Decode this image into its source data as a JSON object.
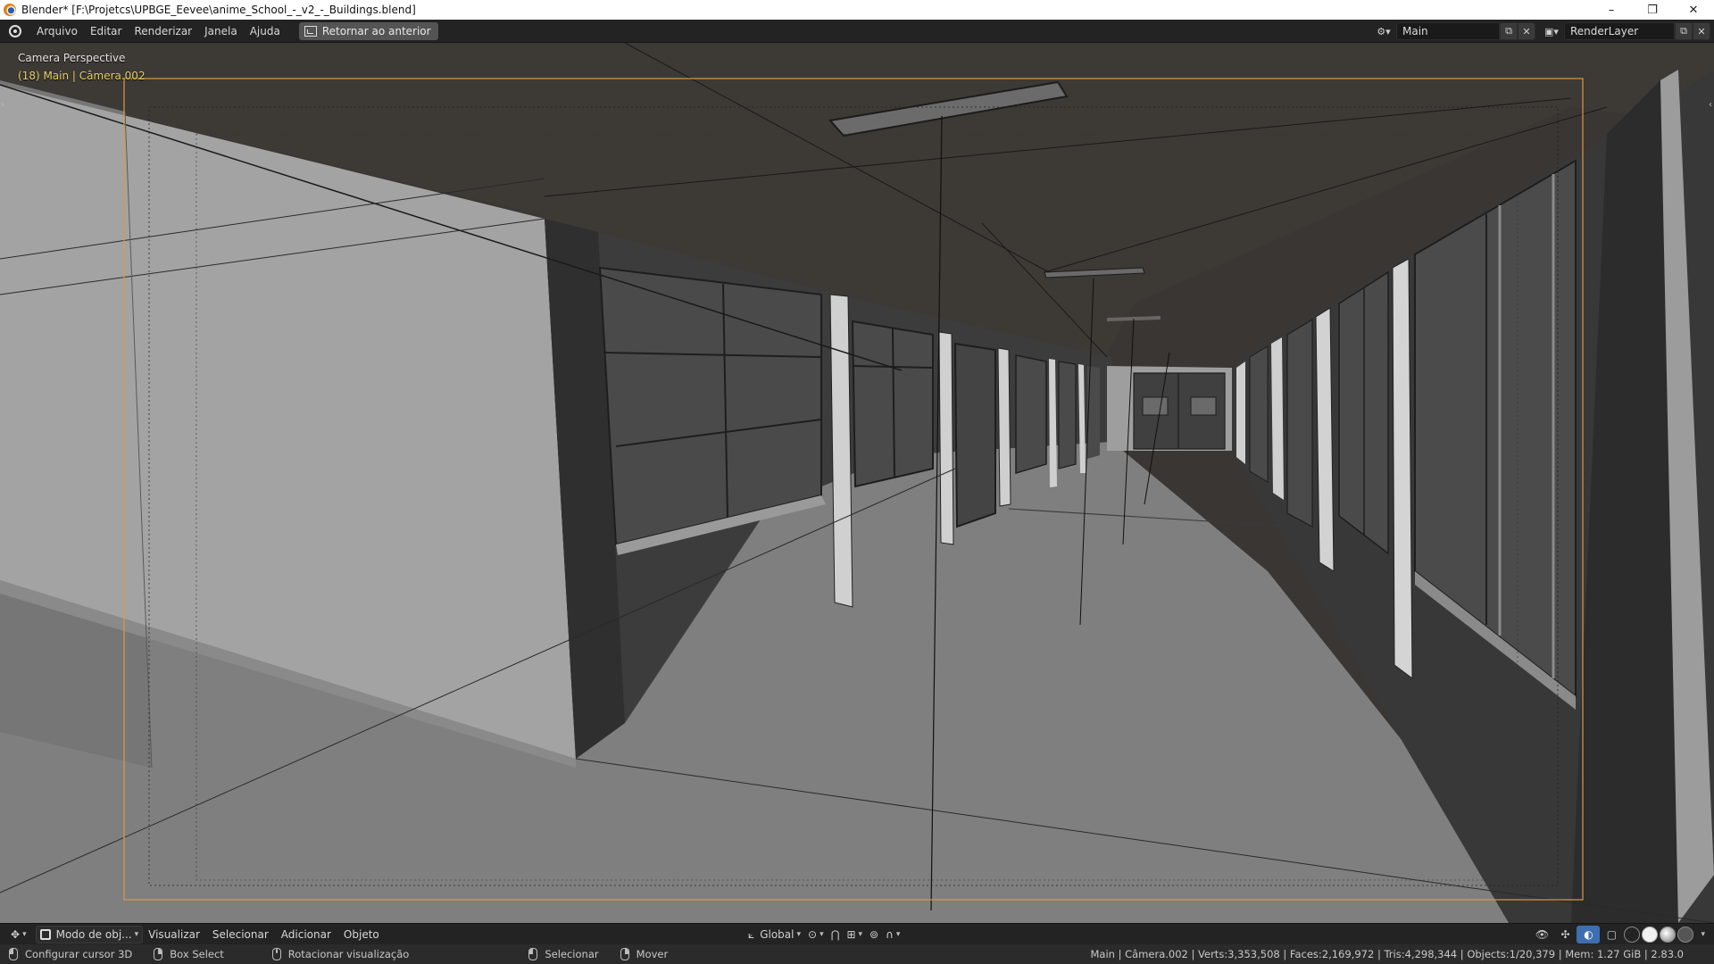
{
  "window": {
    "title": "Blender* [F:\\Projetcs\\UPBGE_Eevee\\anime_School_-_v2_-_Buildings.blend]",
    "controls": {
      "minimize": "–",
      "maximize": "❐",
      "close": "✕"
    }
  },
  "menu": {
    "items": [
      "Arquivo",
      "Editar",
      "Renderizar",
      "Janela",
      "Ajuda"
    ],
    "back_button": "Retornar ao anterior"
  },
  "scene": {
    "name": "Main",
    "render_layer": "RenderLayer"
  },
  "viewport": {
    "label": "Camera Perspective",
    "sublabel": "(18) Main | Câmera.002"
  },
  "header": {
    "mode": "Modo de obj...",
    "items": [
      "Visualizar",
      "Selecionar",
      "Adicionar",
      "Objeto"
    ],
    "orientation": "Global"
  },
  "status": {
    "hints": [
      {
        "label": "Configurar cursor 3D",
        "mouse": "left"
      },
      {
        "label": "Box Select",
        "mouse": "right"
      },
      {
        "label": "Rotacionar visualização",
        "mouse": "mid"
      },
      {
        "label": "Selecionar",
        "mouse": "left"
      },
      {
        "label": "Mover",
        "mouse": "right"
      }
    ],
    "stats": "Main | Câmera.002 | Verts:3,353,508 | Faces:2,169,972 | Tris:4,298,344 | Objects:1/20,379 | Mem: 1.27 GiB | 2.83.0"
  },
  "colors": {
    "ceiling": "#3d3935",
    "floor": "#7f7f7f",
    "left_wall": "#a3a3a3",
    "wall_dark": "#3a3a3a",
    "camera_frame": "#d89a4a",
    "active_accent": "#4a72b8"
  }
}
